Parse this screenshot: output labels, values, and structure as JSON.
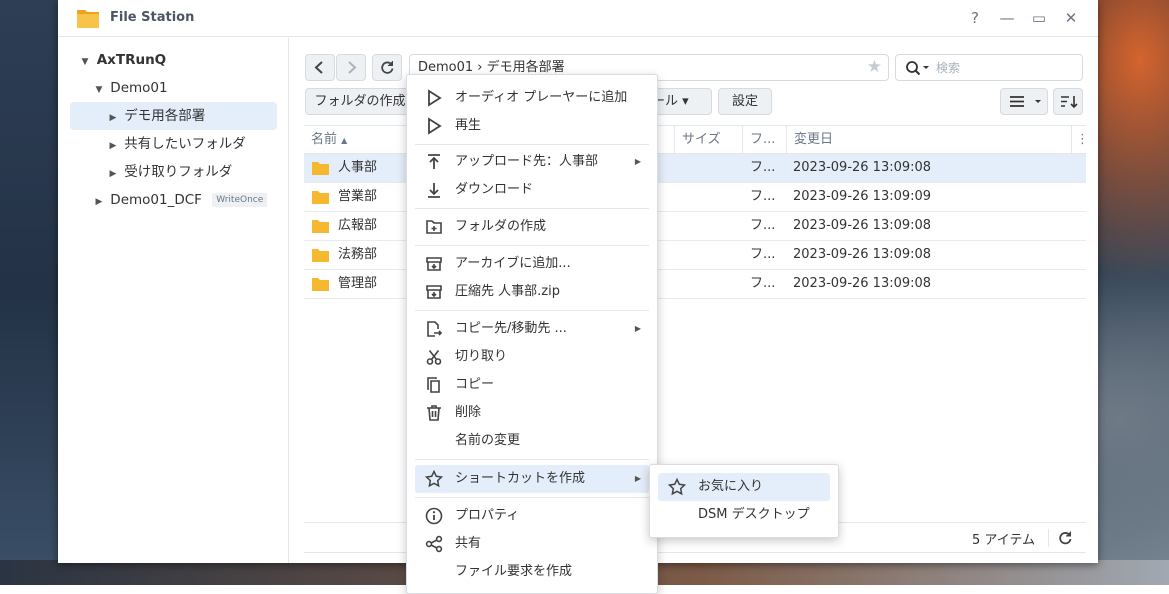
{
  "window": {
    "title": "File Station",
    "help_label": "?",
    "minimize_label": "—",
    "maximize_label": "▭",
    "close_label": "✕"
  },
  "sidebar": {
    "root": "AxTRunQ",
    "demo01": "Demo01",
    "children": [
      "デモ用各部署",
      "共有したいフォルダ",
      "受け取りフォルダ"
    ],
    "demo01_dcf": "Demo01_DCF",
    "demo01_dcf_badge": "WriteOnce"
  },
  "toolbar": {
    "path": "Demo01 › デモ用各部署",
    "search_placeholder": "検索",
    "create_folder_label": "フォルダの作成",
    "tools_label": "ール ▾",
    "settings_label": "設定"
  },
  "list": {
    "columns": {
      "name": "名前",
      "size": "サイズ",
      "type": "フ...",
      "modified": "変更日"
    },
    "rows": [
      {
        "name": "人事部",
        "type": "フ...",
        "modified": "2023-09-26 13:09:08"
      },
      {
        "name": "営業部",
        "type": "フ...",
        "modified": "2023-09-26 13:09:09"
      },
      {
        "name": "広報部",
        "type": "フ...",
        "modified": "2023-09-26 13:09:08"
      },
      {
        "name": "法務部",
        "type": "フ...",
        "modified": "2023-09-26 13:09:08"
      },
      {
        "name": "管理部",
        "type": "フ...",
        "modified": "2023-09-26 13:09:08"
      }
    ],
    "item_count": "5 アイテム"
  },
  "context_menu": {
    "audio_player": "オーディオ プレーヤーに追加",
    "play": "再生",
    "upload_to": "アップロード先：人事部",
    "download": "ダウンロード",
    "create_folder": "フォルダの作成",
    "add_to_archive": "アーカイブに追加...",
    "compress_to": "圧縮先 人事部.zip",
    "copy_move_to": "コピー先/移動先 ...",
    "cut": "切り取り",
    "copy": "コピー",
    "delete": "削除",
    "rename": "名前の変更",
    "create_shortcut": "ショートカットを作成",
    "properties": "プロパティ",
    "share": "共有",
    "file_request": "ファイル要求を作成"
  },
  "submenu": {
    "favorites": "お気に入り",
    "dsm_desktop": "DSM デスクトップ"
  },
  "colors": {
    "accent": "#e4eefa",
    "folder": "#f5b82e"
  }
}
